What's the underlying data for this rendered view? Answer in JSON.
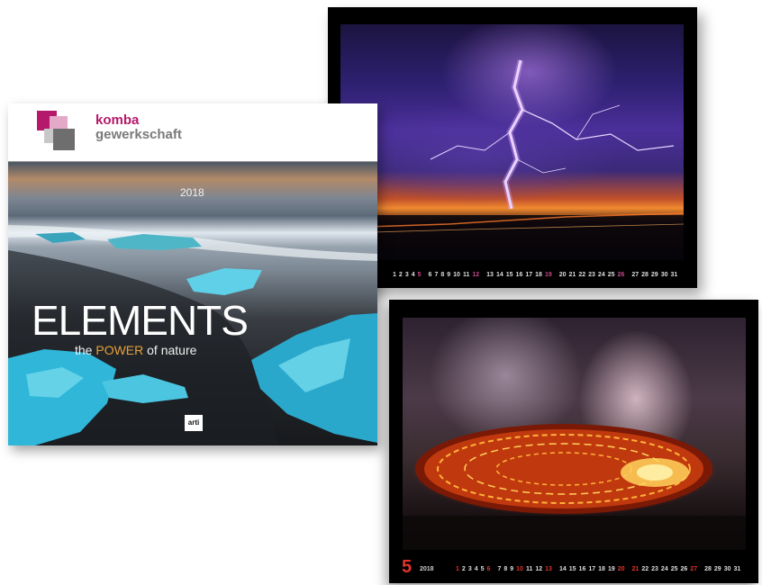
{
  "cover": {
    "brand_line1": "komba",
    "brand_line2": "gewerkschaft",
    "year": "2018",
    "title": "ELEMENTS",
    "subtitle_pre": "the ",
    "subtitle_highlight": "POWER",
    "subtitle_post": " of nature",
    "publisher": "arti"
  },
  "lightning_page": {
    "dates": [
      "1",
      "2",
      "3",
      "4",
      "5",
      "6",
      "7",
      "8",
      "9",
      "10",
      "11",
      "12",
      "13",
      "14",
      "15",
      "16",
      "17",
      "18",
      "19",
      "20",
      "21",
      "22",
      "23",
      "24",
      "25",
      "26",
      "27",
      "28",
      "29",
      "30",
      "31"
    ],
    "sundays": [
      "5",
      "12",
      "19",
      "26"
    ]
  },
  "volcano_page": {
    "month": "5",
    "year": "2018",
    "dates": [
      "1",
      "2",
      "3",
      "4",
      "5",
      "6",
      "7",
      "8",
      "9",
      "10",
      "11",
      "12",
      "13",
      "14",
      "15",
      "16",
      "17",
      "18",
      "19",
      "20",
      "21",
      "22",
      "23",
      "24",
      "25",
      "26",
      "27",
      "28",
      "29",
      "30",
      "31"
    ],
    "red_days": [
      "1",
      "6",
      "10",
      "13",
      "20",
      "21",
      "27"
    ]
  },
  "colors": {
    "brand_magenta": "#b5196b",
    "brand_gray": "#7a7a7a",
    "highlight_orange": "#e8a23a",
    "month_red": "#e0342a"
  }
}
